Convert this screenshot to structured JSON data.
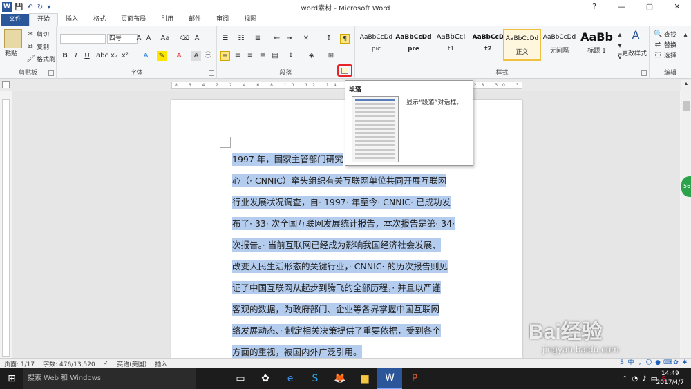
{
  "window": {
    "title": "word素材 - Microsoft Word",
    "controls": [
      "?",
      "—",
      "▢",
      "✕"
    ]
  },
  "tabs": [
    "文件",
    "开始",
    "插入",
    "格式",
    "页面布局",
    "引用",
    "邮件",
    "审阅",
    "视图"
  ],
  "clipboard": {
    "group": "剪贴板",
    "paste": "粘贴",
    "cut": "剪切",
    "copy": "复制",
    "format_painter": "格式刷"
  },
  "font": {
    "group": "字体",
    "font_name": "",
    "font_size": "四号"
  },
  "paragraph": {
    "group": "段落"
  },
  "styles": {
    "group": "样式",
    "items": [
      {
        "preview": "AaBbCcDd",
        "name": "pic"
      },
      {
        "preview": "AaBbCcDd",
        "name": "pre"
      },
      {
        "preview": "AaBbCcI",
        "name": "t1"
      },
      {
        "preview": "AaBbCcD",
        "name": "t2"
      },
      {
        "preview": "AaBbCcDd",
        "name": "正文"
      },
      {
        "preview": "AaBbCcDd",
        "name": "无间隔"
      },
      {
        "preview": "AaBb",
        "name": "标题 1"
      }
    ],
    "change_styles": "更改样式"
  },
  "editing": {
    "group": "编辑",
    "find": "查找",
    "replace": "替换",
    "select": "选择"
  },
  "tooltip": {
    "title": "段落",
    "description": "显示“段落”对话框。"
  },
  "ruler": {
    "numbers": "8 6 4 2 2 4 6 8 10 12 14 16 18 20 22 24 26 28 30 32 34 36 38 40 42"
  },
  "document": {
    "lines": [
      "1997 年，国家主管部门研究",
      "心（· CNNIC）牵头组织有关互联网单位共同开展互联网",
      "行业发展状况调查，自· 1997· 年至今· CNNIC· 已成功发",
      "布了· 33· 次全国互联网发展统计报告，本次报告是第· 34·",
      "次报告。· 当前互联网已经成为影响我国经济社会发展、",
      "改变人民生活形态的关键行业，· CNNIC· 的历次报告则见",
      "证了中国互联网从起步到腾飞的全部历程，· 并且以严谨",
      "客观的数据，为政府部门、企业等各界掌握中国互联网",
      "络发展动态、· 制定相关决策提供了重要依据，受到各个",
      "方面的重视，被国内外广泛引用。"
    ]
  },
  "badge": "56",
  "status": {
    "page": "页面: 1/17",
    "words": "字数: 476/13,520",
    "language": "英语(美国)",
    "mode": "插入"
  },
  "taskbar": {
    "search_placeholder": "搜索 Web 和 Windows",
    "time": "14:49",
    "date": "2017/4/7",
    "ime": "中"
  },
  "watermark": {
    "brand": "Bai经验",
    "url": "jingyan.baidu.com"
  }
}
